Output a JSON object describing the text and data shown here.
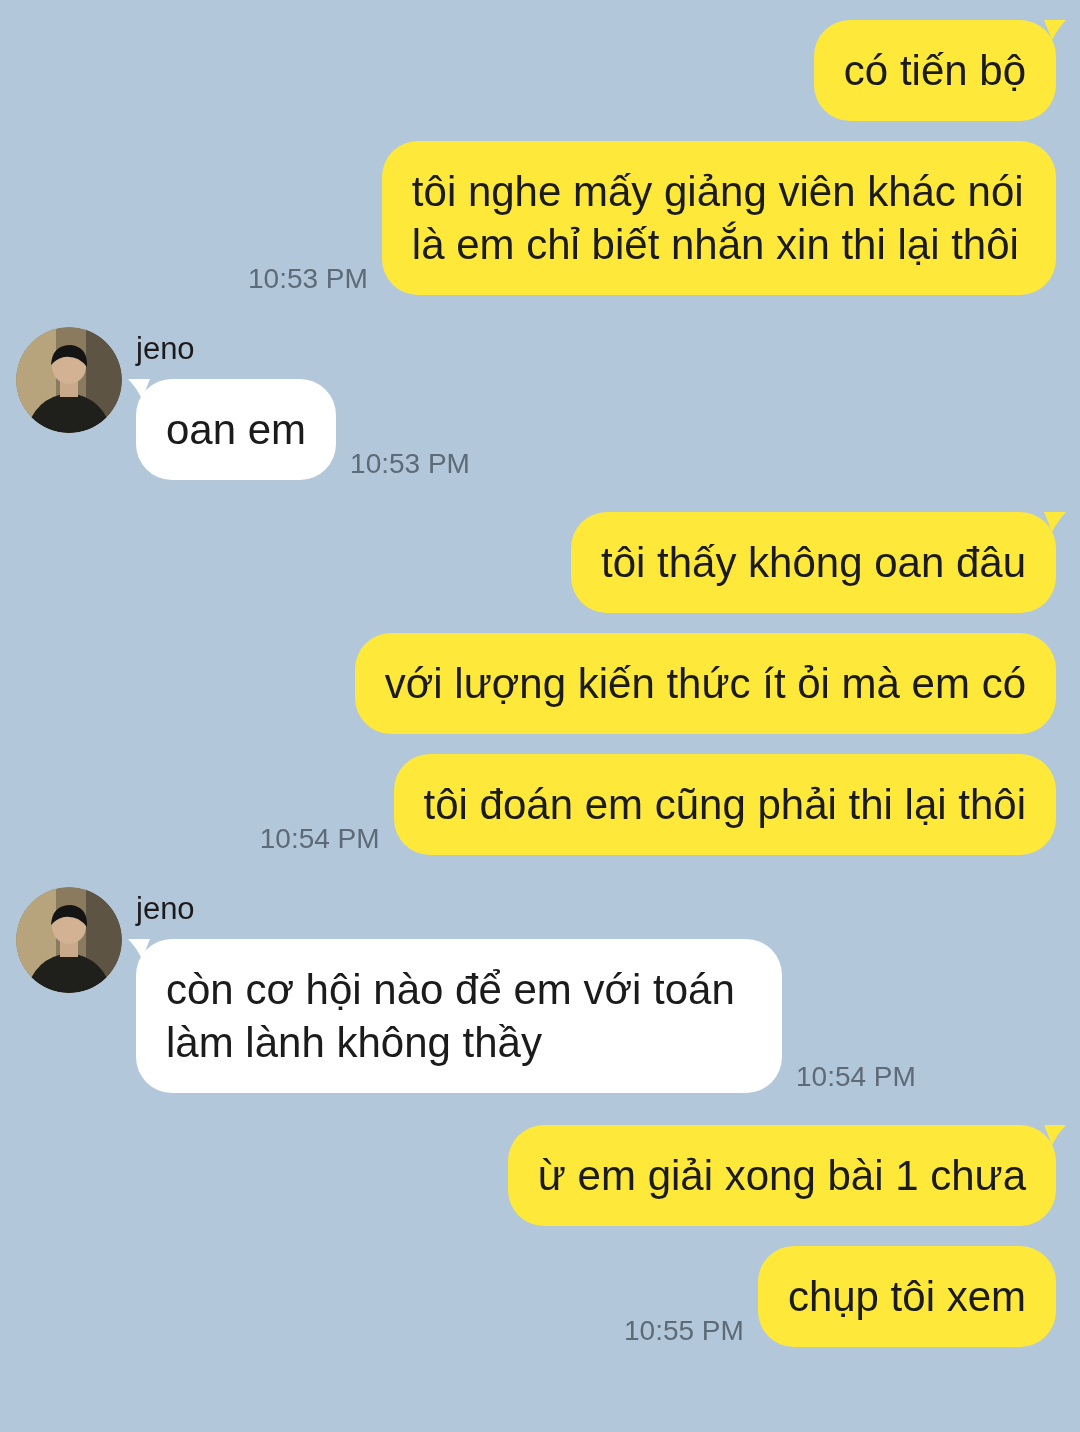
{
  "messages": [
    {
      "kind": "sent",
      "tail": true,
      "text": "có tiến bộ"
    },
    {
      "kind": "sent",
      "tail": false,
      "text": "tôi nghe mấy giảng viên khác nói là em chỉ biết nhắn xin thi lại thôi",
      "time": "10:53 PM"
    },
    {
      "kind": "received",
      "sender": "jeno",
      "text": "oan em",
      "time": "10:53 PM"
    },
    {
      "kind": "sent",
      "tail": true,
      "text": "tôi thấy không oan đâu"
    },
    {
      "kind": "sent",
      "tail": false,
      "text": "với lượng kiến thức ít ỏi mà em có"
    },
    {
      "kind": "sent",
      "tail": false,
      "text": "tôi đoán em cũng phải thi lại thôi",
      "time": "10:54 PM"
    },
    {
      "kind": "received",
      "sender": "jeno",
      "text": "còn cơ hội nào để em với toán làm lành không thầy",
      "time": "10:54 PM"
    },
    {
      "kind": "sent",
      "tail": true,
      "text": "ừ em giải xong bài 1 chưa"
    },
    {
      "kind": "sent",
      "tail": false,
      "text": "chụp tôi xem",
      "time": "10:55 PM"
    }
  ]
}
